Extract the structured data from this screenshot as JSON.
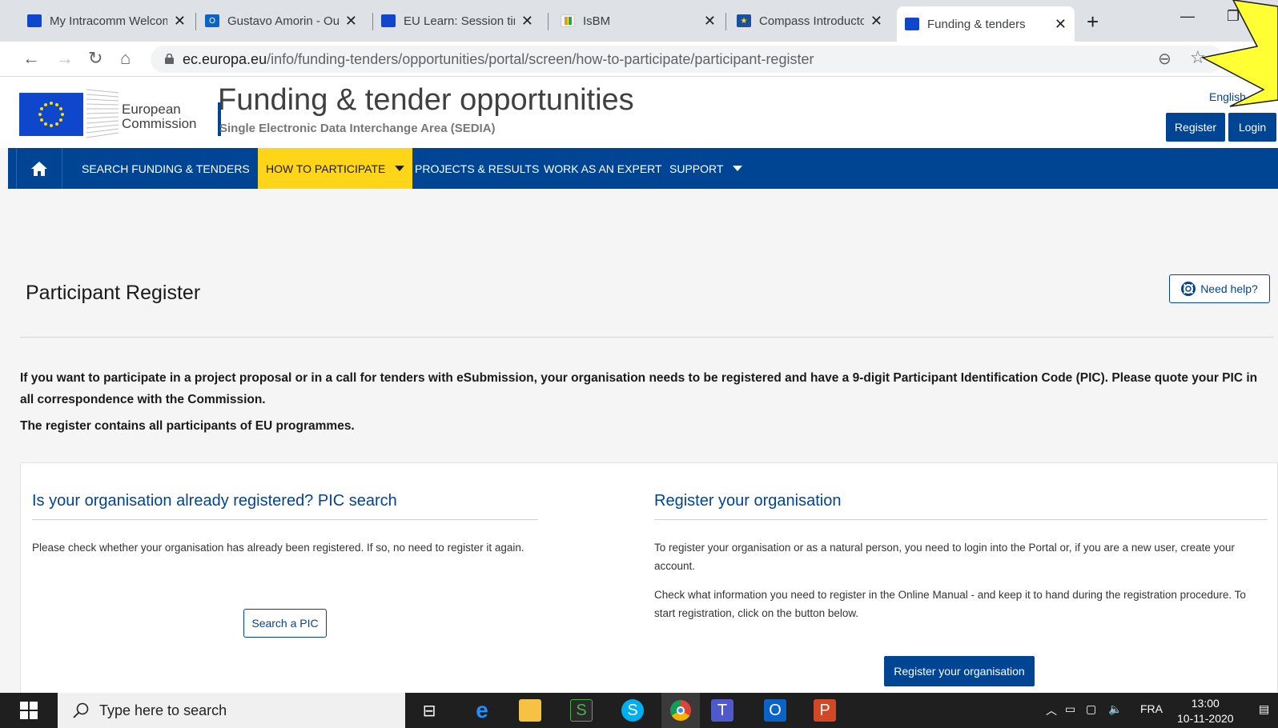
{
  "browser": {
    "tabs": [
      {
        "title": "My Intracomm Welcome",
        "favicon": "eu-flag"
      },
      {
        "title": "Gustavo Amorin - Outlook",
        "favicon": "outlook"
      },
      {
        "title": "EU Learn: Session time",
        "favicon": "eu-flag"
      },
      {
        "title": "IsBM",
        "favicon": "isbm"
      },
      {
        "title": "Compass Introductory",
        "favicon": "compass"
      },
      {
        "title": "Funding & tenders",
        "favicon": "eu-flag"
      }
    ],
    "url_host": "ec.europa.eu",
    "url_path": "/info/funding-tenders/opportunities/portal/screen/how-to-participate/participant-register"
  },
  "header": {
    "logo_line1": "European",
    "logo_line2": "Commission",
    "title": "Funding & tender opportunities",
    "subtitle": "Single Electronic Data Interchange Area (SEDIA)",
    "language": "English",
    "register_label": "Register",
    "login_label": "Login"
  },
  "nav": {
    "items": [
      {
        "label": "SEARCH FUNDING & TENDERS",
        "dropdown": true
      },
      {
        "label": "HOW TO PARTICIPATE",
        "dropdown": true,
        "active": true
      },
      {
        "label": "PROJECTS & RESULTS",
        "dropdown": false
      },
      {
        "label": "WORK AS AN EXPERT",
        "dropdown": false
      },
      {
        "label": "SUPPORT",
        "dropdown": true
      }
    ]
  },
  "main": {
    "title": "Participant Register",
    "help_label": "Need help?",
    "intro": "If you want to participate in a project proposal or in a call for tenders with eSubmission, your organisation needs to be registered and have a 9-digit Participant Identification Code (PIC). Please quote your PIC in all correspondence with the Commission.",
    "intro2": "The register contains all participants of EU programmes.",
    "left": {
      "title": "Is your organisation already registered? PIC search",
      "text": "Please check whether your organisation has already been registered. If so, no need to register it again.",
      "button": "Search a PIC"
    },
    "right": {
      "title": "Register your organisation",
      "text1": "To register your organisation or as a natural person, you need to login into the Portal or, if you are a new user, create your account.",
      "text2": "Check what information you need to register in the Online Manual - and keep it to hand during the registration procedure. To start registration, click on the button below.",
      "button": "Register your organisation"
    }
  },
  "taskbar": {
    "search_placeholder": "Type here to search",
    "language": "FRA",
    "time": "13:00",
    "date": "10-11-2020"
  },
  "colors": {
    "ec_blue": "#004494",
    "active_yellow": "#ffd617",
    "callout_yellow": "#ffff33"
  }
}
